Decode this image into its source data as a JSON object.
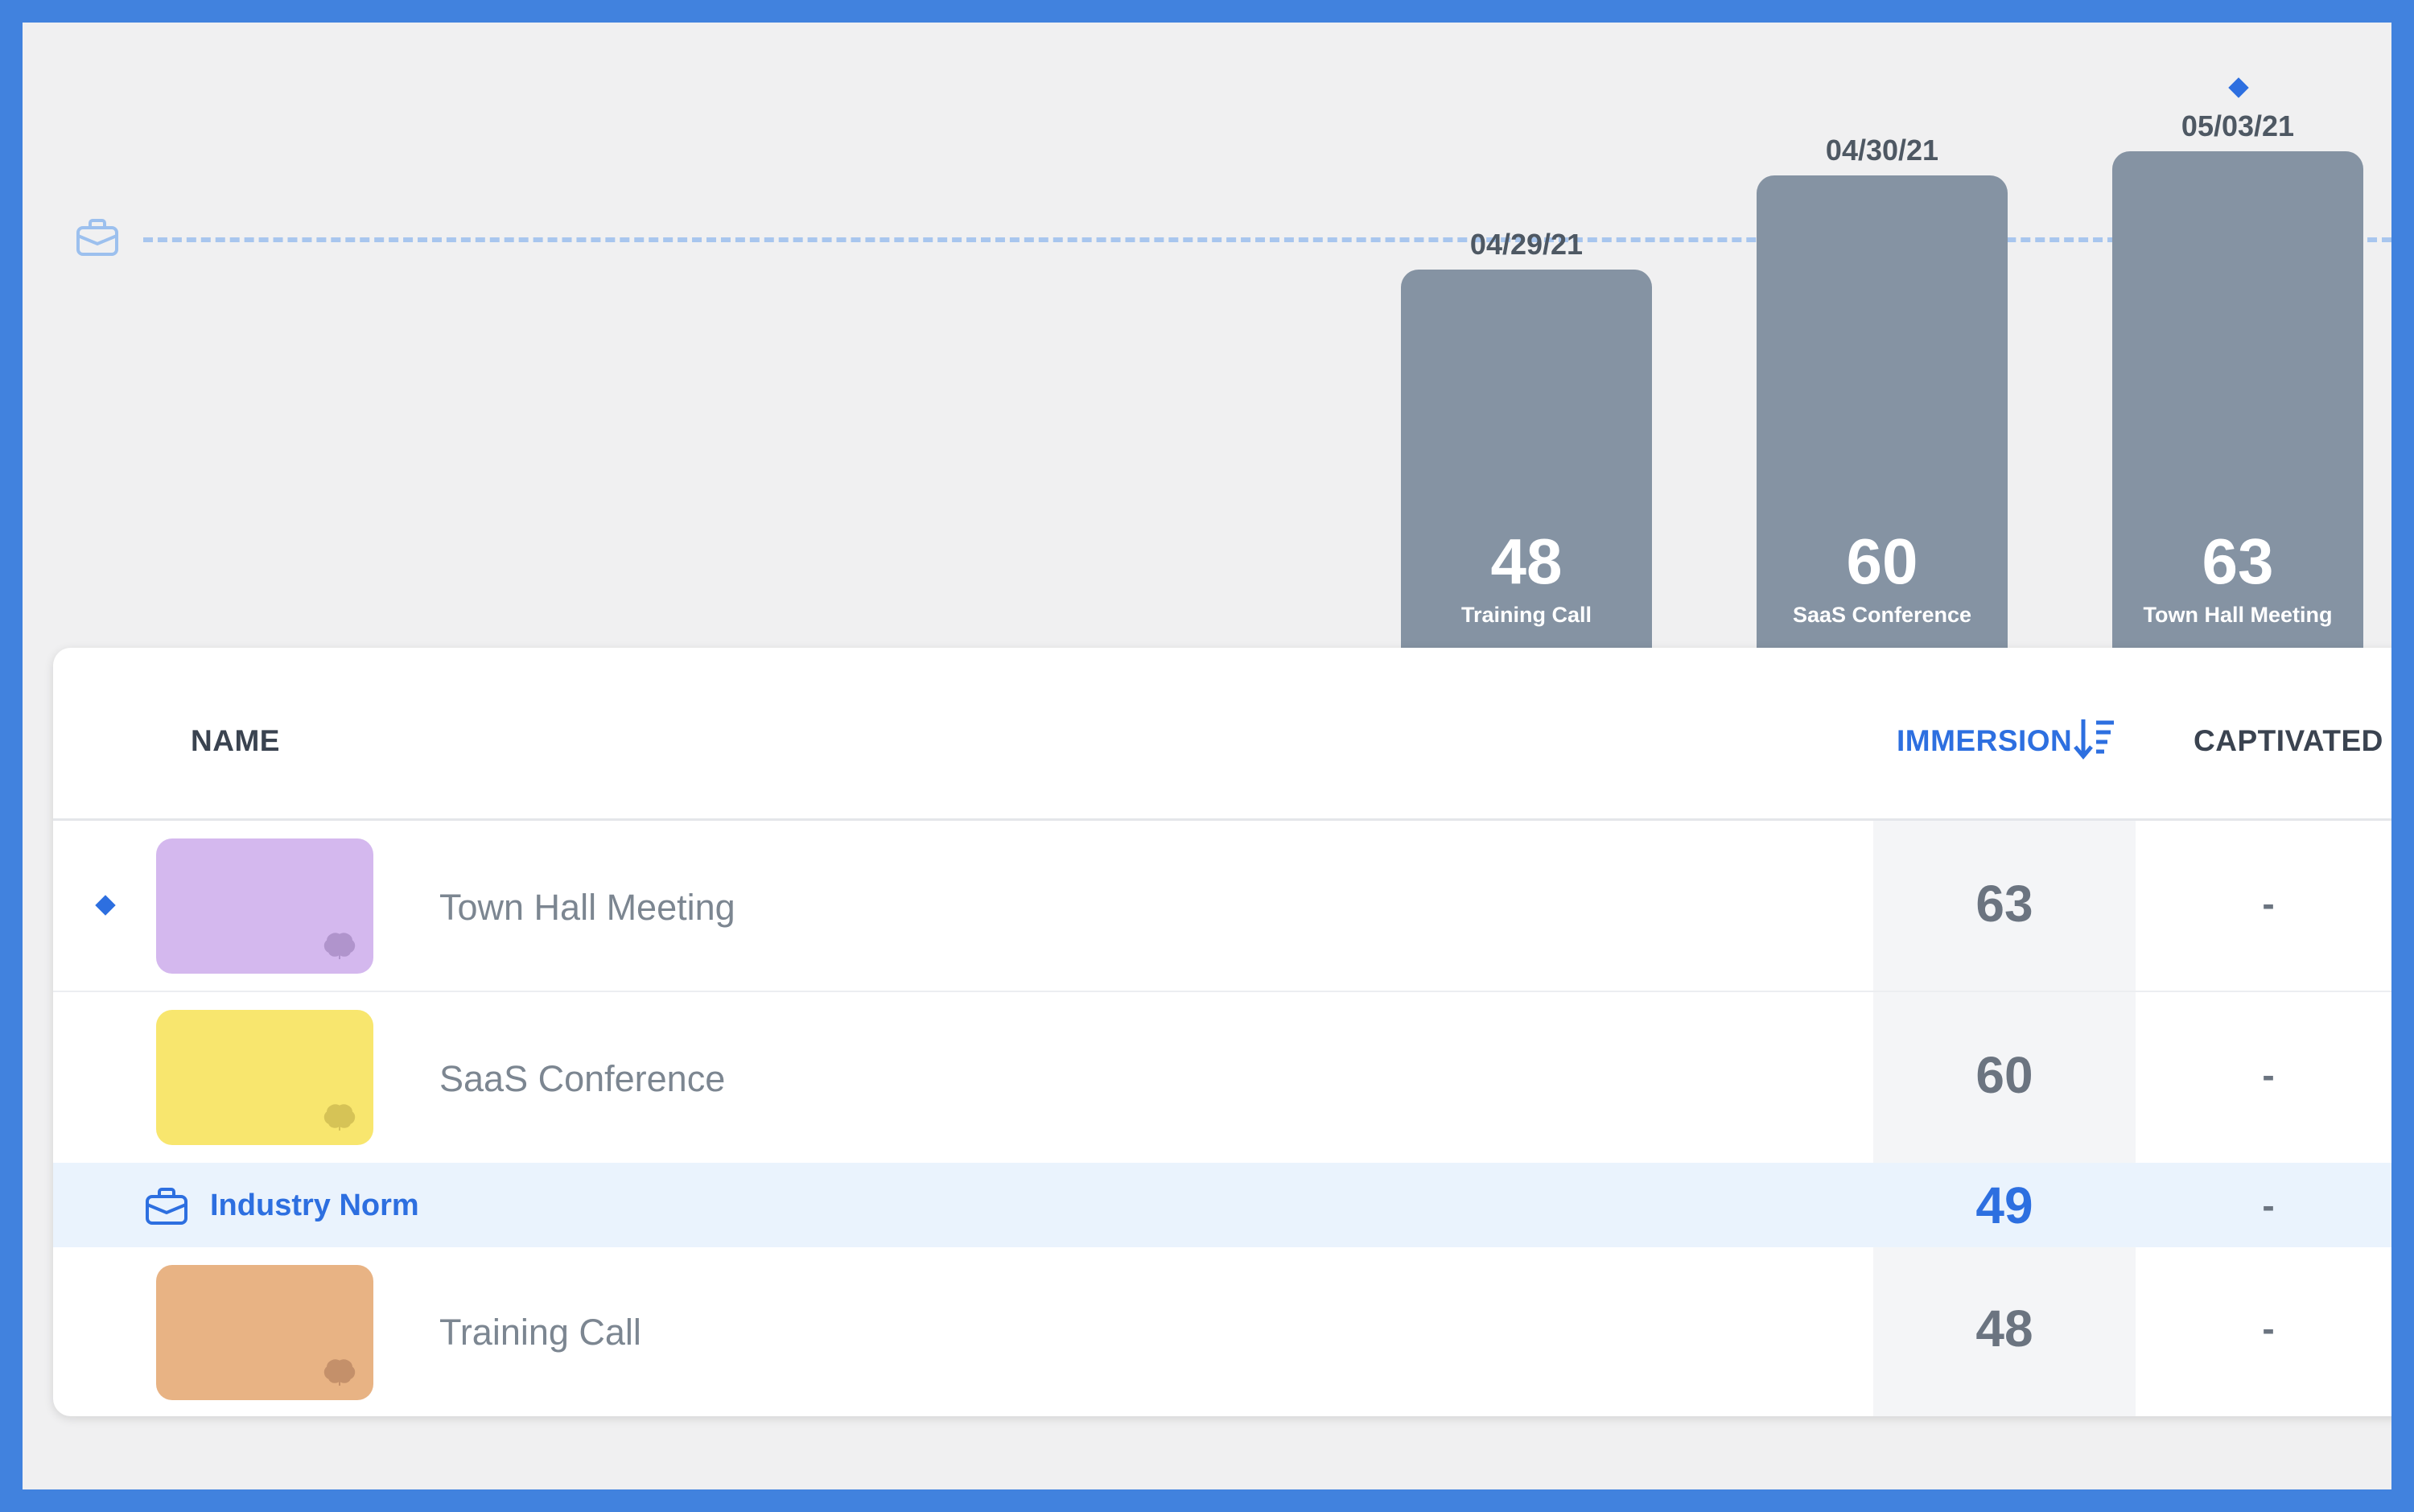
{
  "chart_data": {
    "type": "bar",
    "categories": [
      "Training Call",
      "SaaS Conference",
      "Town Hall Meeting"
    ],
    "dates": [
      "04/29/21",
      "04/30/21",
      "05/03/21"
    ],
    "values": [
      48,
      60,
      63
    ],
    "reference_line": {
      "value": 49,
      "icon": "briefcase-icon"
    },
    "pinned_category": "Town Hall Meeting",
    "bar_color": "#8593a3",
    "reference_color": "#a8c6ee"
  },
  "table": {
    "headers": {
      "name": "NAME",
      "immersion": "IMMERSION",
      "captivated": "CAPTIVATED"
    },
    "sort_icon": "sort-descending-icon",
    "rows": [
      {
        "name": "Town Hall Meeting",
        "immersion": "63",
        "captivated": "-",
        "thumb_color": "#d4b8ee",
        "pinned": true
      },
      {
        "name": "SaaS Conference",
        "immersion": "60",
        "captivated": "-",
        "thumb_color": "#f8e66e",
        "pinned": false
      },
      {
        "name": "Training Call",
        "immersion": "48",
        "captivated": "-",
        "thumb_color": "#e8b384",
        "pinned": false
      }
    ],
    "norm_row": {
      "name": "Industry Norm",
      "immersion": "49",
      "captivated": "-",
      "icon": "briefcase-icon"
    }
  },
  "colors": {
    "accent": "#2d6fe0",
    "frame": "#4182de",
    "background": "#f0f0f1"
  }
}
